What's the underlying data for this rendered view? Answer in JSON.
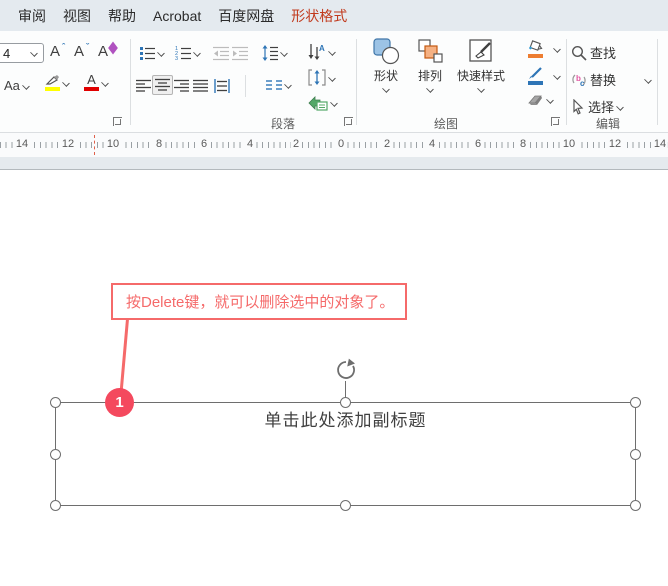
{
  "tabs": {
    "review": "审阅",
    "view": "视图",
    "help": "帮助",
    "acrobat": "Acrobat",
    "baidu": "百度网盘",
    "shape_format": "形状格式"
  },
  "font_group": {
    "size_value": "4",
    "grow_label": "A",
    "shrink_label": "A",
    "clear_label": "A",
    "case_label": "Aa",
    "color_label": "A"
  },
  "paragraph_group": {
    "label": "段落"
  },
  "drawing_group": {
    "label": "绘图",
    "shapes": "形状",
    "arrange": "排列",
    "quick_styles": "快速样式"
  },
  "edit_group": {
    "label": "编辑",
    "find": "查找",
    "replace": "替换",
    "select": "选择"
  },
  "ruler": {
    "numbers": [
      "14",
      "12",
      "10",
      "8",
      "6",
      "4",
      "2",
      "0",
      "2",
      "4",
      "6",
      "8",
      "10",
      "12",
      "14"
    ]
  },
  "slide": {
    "callout_text": "按Delete键，就可以删除选中的对象了。",
    "callout_marker": "1",
    "placeholder_text": "单击此处添加副标题"
  },
  "colors": {
    "active_tab": "#c13a1d",
    "tabbar_bg": "#e4eaef",
    "callout_pink": "#f56a6a",
    "marker_red": "#f4495e",
    "accent_blue": "#2e75b6",
    "highlight_yellow": "#ffff00",
    "font_color_red": "#e00000",
    "arrange_orange": "#f5b183",
    "smartart_green": "#54a868"
  }
}
